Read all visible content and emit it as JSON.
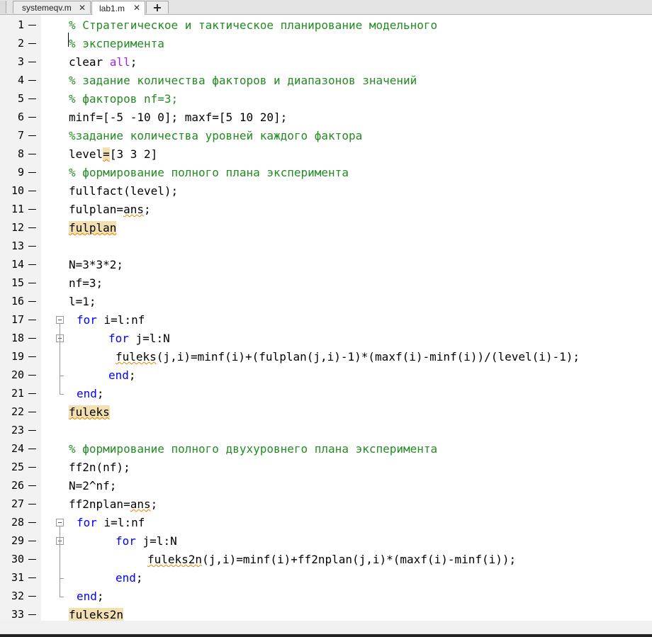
{
  "tabs": [
    {
      "label": "systemeqv.m",
      "active": false
    },
    {
      "label": "lab1.m",
      "active": true
    }
  ],
  "new_tab_label": "+",
  "close_glyph": "✕",
  "lines": [
    {
      "n": "1",
      "indent": 0,
      "segs": [
        [
          "cm",
          "% Стратегическое и тактическое планирование модельного"
        ]
      ]
    },
    {
      "n": "2",
      "indent": 0,
      "segs": [
        [
          "cm",
          "% эксперимента"
        ]
      ]
    },
    {
      "n": "3",
      "indent": 0,
      "segs": [
        [
          "",
          "clear "
        ],
        [
          "str",
          "all"
        ],
        [
          "",
          ";"
        ]
      ]
    },
    {
      "n": "4",
      "indent": 0,
      "segs": [
        [
          "cm",
          "% задание количества факторов и диапазонов значений"
        ]
      ]
    },
    {
      "n": "5",
      "indent": 0,
      "segs": [
        [
          "cm",
          "% факторов nf=3;"
        ]
      ]
    },
    {
      "n": "6",
      "indent": 0,
      "segs": [
        [
          "",
          "minf=[-5 -10 0]; maxf=[5 10 20];"
        ]
      ]
    },
    {
      "n": "7",
      "indent": 0,
      "segs": [
        [
          "cm",
          "%задание количества уровней каждого фактора"
        ]
      ]
    },
    {
      "n": "8",
      "indent": 0,
      "segs": [
        [
          "",
          "level"
        ],
        [
          "hlsq",
          "="
        ],
        [
          "",
          "[3 3 2]"
        ]
      ]
    },
    {
      "n": "9",
      "indent": 0,
      "segs": [
        [
          "cm",
          "% формирование полного плана эксперимента"
        ]
      ]
    },
    {
      "n": "10",
      "indent": 0,
      "segs": [
        [
          "",
          "fullfact(level);"
        ]
      ]
    },
    {
      "n": "11",
      "indent": 0,
      "segs": [
        [
          "",
          "fulplan="
        ],
        [
          "sq",
          "ans"
        ],
        [
          "",
          ";"
        ]
      ]
    },
    {
      "n": "12",
      "indent": 0,
      "segs": [
        [
          "hlsq",
          "fulplan"
        ]
      ]
    },
    {
      "n": "13",
      "indent": 0,
      "segs": []
    },
    {
      "n": "14",
      "indent": 0,
      "segs": [
        [
          "",
          "N=3*3*2;"
        ]
      ]
    },
    {
      "n": "15",
      "indent": 0,
      "segs": [
        [
          "",
          "nf=3;"
        ]
      ]
    },
    {
      "n": "16",
      "indent": 0,
      "segs": [
        [
          "",
          "l=1;"
        ]
      ]
    },
    {
      "n": "17",
      "indent": 11,
      "segs": [
        [
          "kw",
          "for"
        ],
        [
          "",
          " i=l:nf"
        ]
      ]
    },
    {
      "n": "18",
      "indent": 56,
      "segs": [
        [
          "kw",
          "for"
        ],
        [
          "",
          " j=l:N"
        ]
      ]
    },
    {
      "n": "19",
      "indent": 66,
      "segs": [
        [
          "sq",
          "fuleks"
        ],
        [
          "",
          "(j,i)=minf(i)+(fulplan(j,i)-1)*(maxf(i)-minf(i))/(level(i)-1);"
        ]
      ]
    },
    {
      "n": "20",
      "indent": 56,
      "segs": [
        [
          "kw",
          "end"
        ],
        [
          "",
          ";"
        ]
      ]
    },
    {
      "n": "21",
      "indent": 11,
      "segs": [
        [
          "kw",
          "end"
        ],
        [
          "",
          ";"
        ]
      ]
    },
    {
      "n": "22",
      "indent": 0,
      "segs": [
        [
          "hlsq",
          "fuleks"
        ]
      ]
    },
    {
      "n": "23",
      "indent": 0,
      "segs": []
    },
    {
      "n": "24",
      "indent": 0,
      "segs": [
        [
          "cm",
          "% формирование полного двухуровнего плана эксперимента"
        ]
      ]
    },
    {
      "n": "25",
      "indent": 0,
      "segs": [
        [
          "",
          "ff2n(nf);"
        ]
      ]
    },
    {
      "n": "26",
      "indent": 0,
      "segs": [
        [
          "",
          "N=2^nf;"
        ]
      ]
    },
    {
      "n": "27",
      "indent": 0,
      "segs": [
        [
          "",
          "ff2nplan="
        ],
        [
          "sq",
          "ans"
        ],
        [
          "",
          ";"
        ]
      ]
    },
    {
      "n": "28",
      "indent": 11,
      "segs": [
        [
          "kw",
          "for"
        ],
        [
          "",
          " i=l:nf"
        ]
      ]
    },
    {
      "n": "29",
      "indent": 66,
      "segs": [
        [
          "kw",
          "for"
        ],
        [
          "",
          " j=l:N"
        ]
      ]
    },
    {
      "n": "30",
      "indent": 111,
      "segs": [
        [
          "sq",
          "fuleks2n"
        ],
        [
          "",
          "(j,i)=minf(i)+ff2nplan(j,i)*(maxf(i)-minf(i));"
        ]
      ]
    },
    {
      "n": "31",
      "indent": 66,
      "segs": [
        [
          "kw",
          "end"
        ],
        [
          "",
          ";"
        ]
      ]
    },
    {
      "n": "32",
      "indent": 11,
      "segs": [
        [
          "kw",
          "end"
        ],
        [
          "",
          ";"
        ]
      ]
    },
    {
      "n": "33",
      "indent": 0,
      "segs": [
        [
          "hl",
          "fuleks2n"
        ]
      ]
    }
  ],
  "colors": {
    "comment": "#228b22",
    "keyword": "#0000ff",
    "string": "#a020f0",
    "highlight": "#f2e0b2"
  }
}
